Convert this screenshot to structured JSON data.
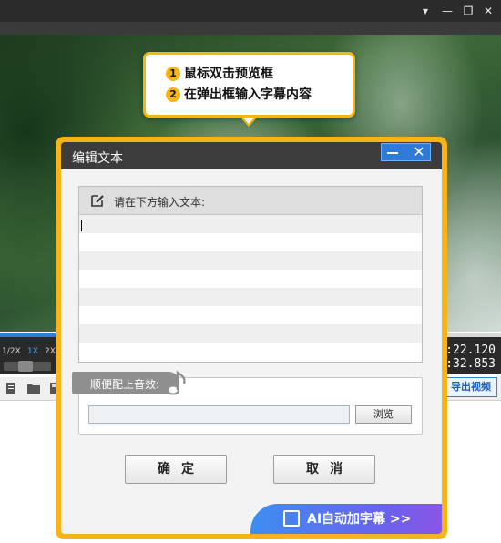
{
  "app": {
    "window_controls": [
      "▾",
      "—",
      "❐",
      "✕"
    ],
    "speeds": [
      "1/2X",
      "1X",
      "2X"
    ],
    "selected_speed": "1X",
    "current_time": "0:22.120",
    "total_time": "0:32.853",
    "progress": 0.62,
    "export_label": "导出视频"
  },
  "tooltip": {
    "steps": [
      {
        "num": "1",
        "text": "鼠标双击预览框"
      },
      {
        "num": "2",
        "text": "在弹出框输入字幕内容"
      }
    ]
  },
  "dialog": {
    "title": "编辑文本",
    "text_header": "请在下方输入文本:",
    "text_value": "",
    "sound_label": "顺便配上音效:",
    "sound_value": "",
    "browse_label": "浏览",
    "confirm_label": "确定",
    "cancel_label": "取消",
    "ai_label": "AI自动加字幕 >>"
  },
  "colors": {
    "accent": "#f6b416",
    "blue": "#2e7ad6",
    "dialog_title_bg": "#3c3c3c"
  }
}
